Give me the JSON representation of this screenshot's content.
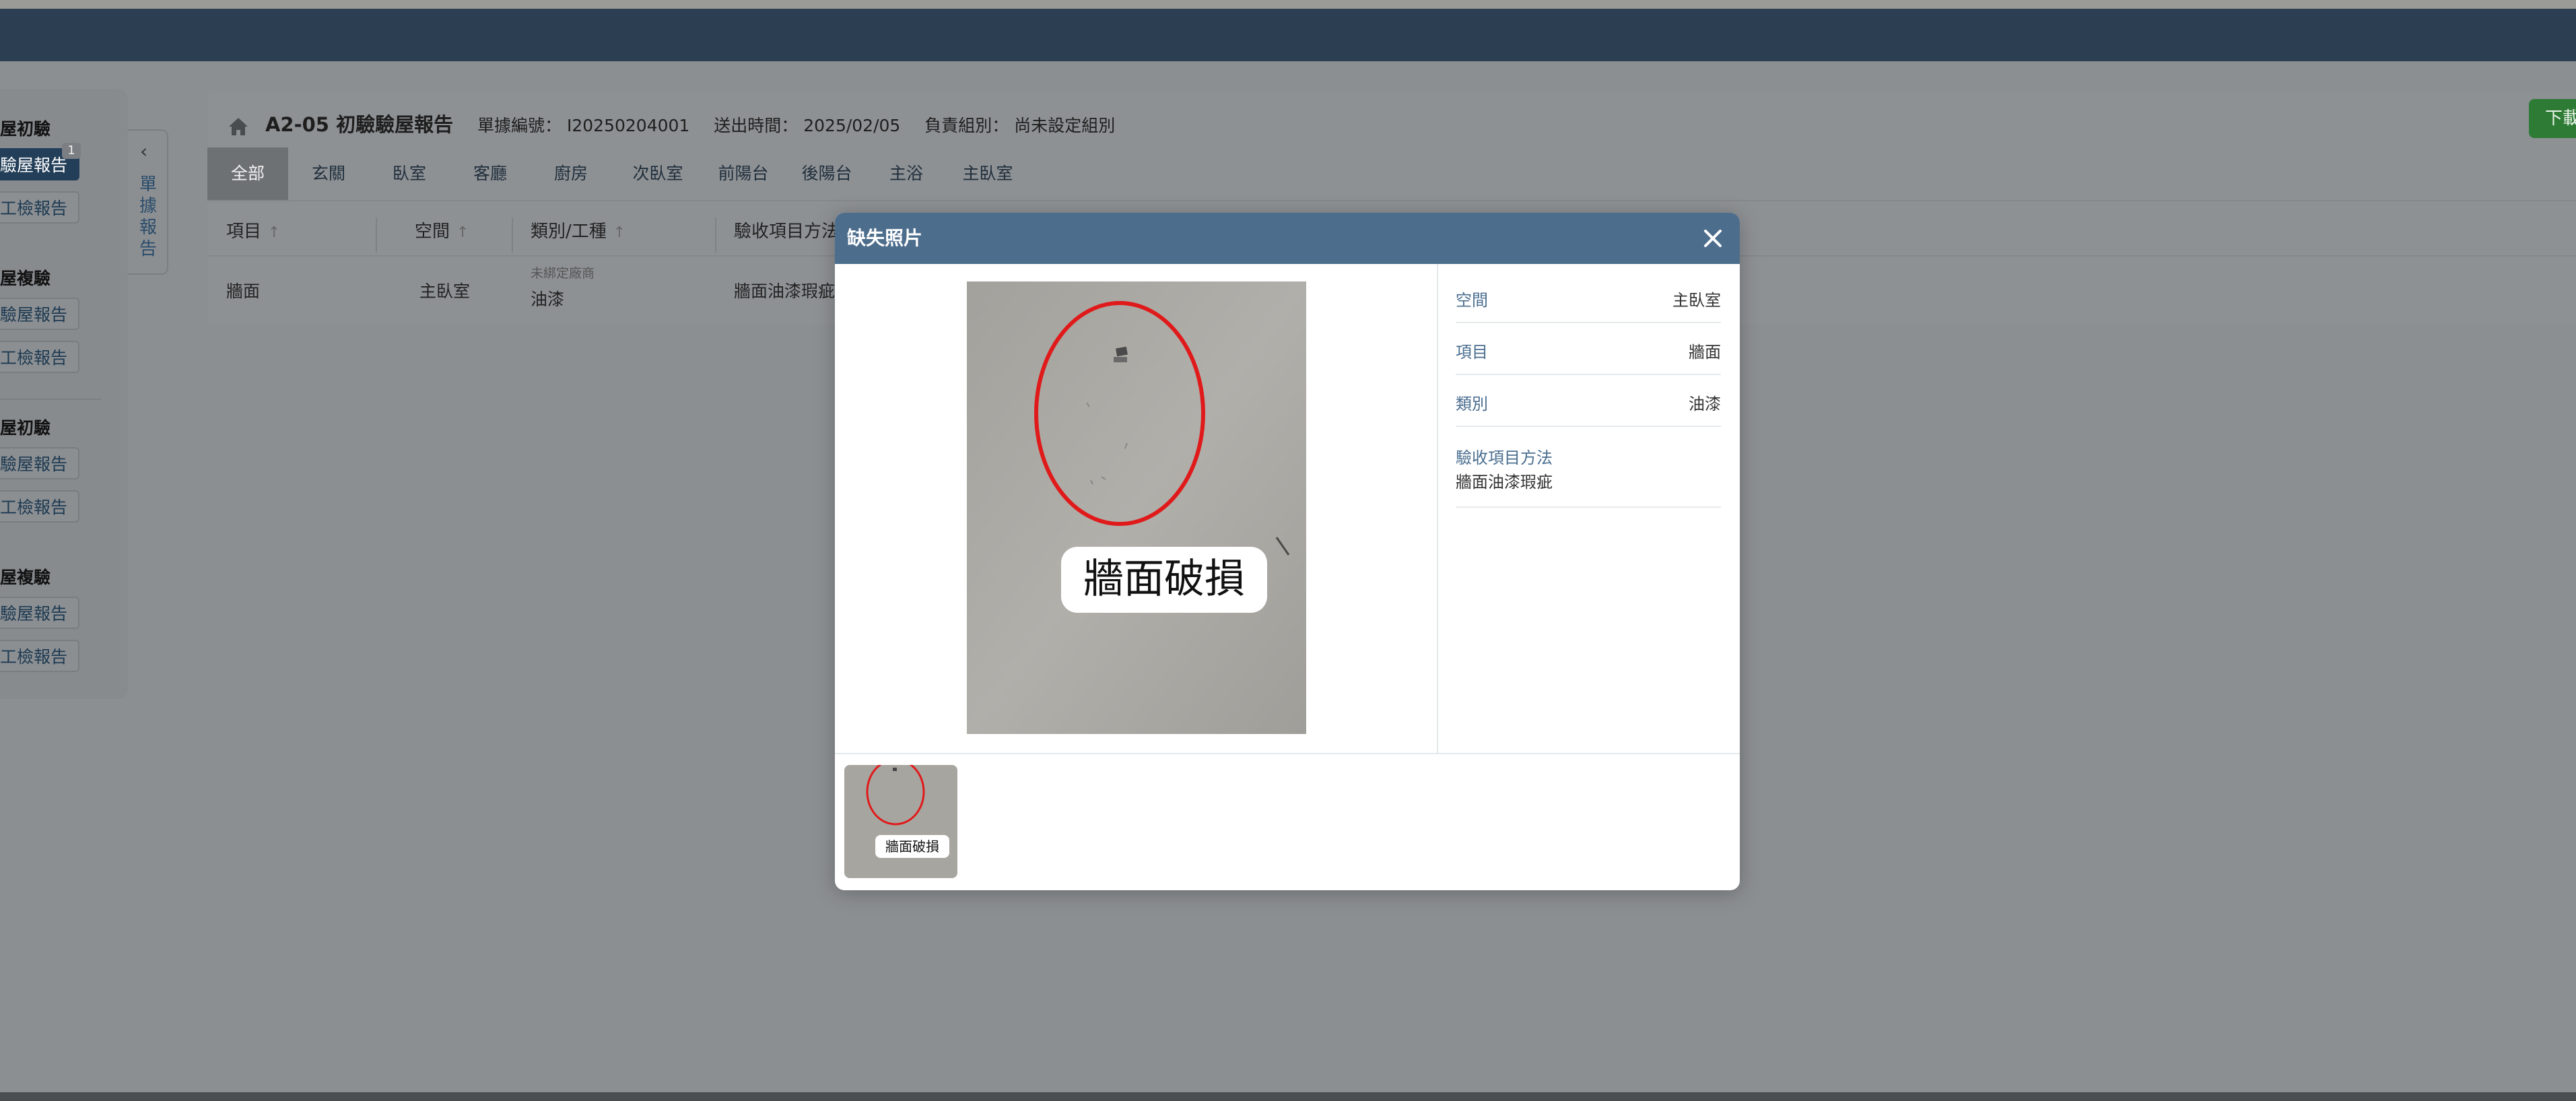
{
  "sidebar": {
    "groups": [
      {
        "title": "屋初驗",
        "items": [
          {
            "label": "驗屋報告",
            "active": true,
            "badge": "1"
          },
          {
            "label": "工檢報告"
          }
        ]
      },
      {
        "title": "屋複驗",
        "items": [
          {
            "label": "驗屋報告"
          },
          {
            "label": "工檢報告"
          }
        ]
      },
      {
        "title": "屋初驗",
        "items": [
          {
            "label": "驗屋報告"
          },
          {
            "label": "工檢報告"
          }
        ]
      },
      {
        "title": "屋複驗",
        "items": [
          {
            "label": "驗屋報告"
          },
          {
            "label": "工檢報告"
          }
        ]
      }
    ]
  },
  "vtab": {
    "chevron": "‹",
    "label": "單據報告"
  },
  "header": {
    "title": "A2-05 初驗驗屋報告",
    "doc_no": "單據編號： I20250204001",
    "sent_time": "送出時間： 2025/02/05",
    "team": "負責組別： 尚未設定組別",
    "download_label": "下載"
  },
  "tabs": [
    "全部",
    "玄關",
    "臥室",
    "客廳",
    "廚房",
    "次臥室",
    "前陽台",
    "後陽台",
    "主浴",
    "主臥室"
  ],
  "table": {
    "headers": [
      "項目",
      "空間",
      "類別/工種",
      "驗收項目方法"
    ],
    "rows": [
      {
        "item": "牆面",
        "space": "主臥室",
        "vendor_note": "未綁定廠商",
        "category": "油漆",
        "method": "牆面油漆瑕疵"
      }
    ]
  },
  "modal": {
    "title": "缺失照片",
    "photo_caption": "牆面破損",
    "thumb_caption": "牆面破損",
    "info": {
      "space_label": "空間",
      "space_value": "主臥室",
      "item_label": "項目",
      "item_value": "牆面",
      "category_label": "類別",
      "category_value": "油漆",
      "method_label": "驗收項目方法",
      "method_value": "牆面油漆瑕疵"
    }
  },
  "colors": {
    "topbar": "#2c3f52",
    "modal_header": "#4c6d8c",
    "download": "#2e7b35",
    "annotation": "#e01a1a"
  }
}
